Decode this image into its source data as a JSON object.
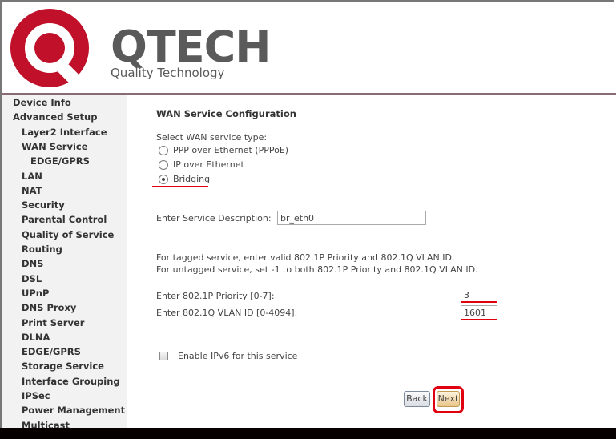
{
  "header": {
    "brand": "QTECH",
    "tagline": "Quality Technology",
    "logo_color": "#c0102a"
  },
  "sidebar": {
    "items": [
      {
        "label": "Device Info",
        "level": 0
      },
      {
        "label": "Advanced Setup",
        "level": 0
      },
      {
        "label": "Layer2 Interface",
        "level": 1
      },
      {
        "label": "WAN Service",
        "level": 1
      },
      {
        "label": "EDGE/GPRS",
        "level": 2
      },
      {
        "label": "LAN",
        "level": 1
      },
      {
        "label": "NAT",
        "level": 1
      },
      {
        "label": "Security",
        "level": 1
      },
      {
        "label": "Parental Control",
        "level": 1
      },
      {
        "label": "Quality of Service",
        "level": 1
      },
      {
        "label": "Routing",
        "level": 1
      },
      {
        "label": "DNS",
        "level": 1
      },
      {
        "label": "DSL",
        "level": 1
      },
      {
        "label": "UPnP",
        "level": 1
      },
      {
        "label": "DNS Proxy",
        "level": 1
      },
      {
        "label": "Print Server",
        "level": 1
      },
      {
        "label": "DLNA",
        "level": 1
      },
      {
        "label": "EDGE/GPRS",
        "level": 1
      },
      {
        "label": "Storage Service",
        "level": 1
      },
      {
        "label": "Interface Grouping",
        "level": 1
      },
      {
        "label": "IPSec",
        "level": 1
      },
      {
        "label": "Power Management",
        "level": 1
      },
      {
        "label": "Multicast",
        "level": 1
      }
    ]
  },
  "main": {
    "title": "WAN Service Configuration",
    "service_type_label": "Select WAN service type:",
    "service_types": [
      {
        "label": "PPP over Ethernet (PPPoE)",
        "selected": false
      },
      {
        "label": "IP over Ethernet",
        "selected": false
      },
      {
        "label": "Bridging",
        "selected": true
      }
    ],
    "description_label": "Enter Service Description:",
    "description_value": "br_eth0",
    "vlan_note_1": "For tagged service, enter valid 802.1P Priority and 802.1Q VLAN ID.",
    "vlan_note_2": "For untagged service, set -1 to both 802.1P Priority and 802.1Q VLAN ID.",
    "priority_label": "Enter 802.1P Priority [0-7]:",
    "priority_value": "3",
    "vlan_label": "Enter 802.1Q VLAN ID [0-4094]:",
    "vlan_value": "1601",
    "ipv6_label": "Enable IPv6 for this service",
    "ipv6_checked": false,
    "back_label": "Back",
    "next_label": "Next"
  },
  "annotations": {
    "highlight_color": "#e0000e"
  }
}
